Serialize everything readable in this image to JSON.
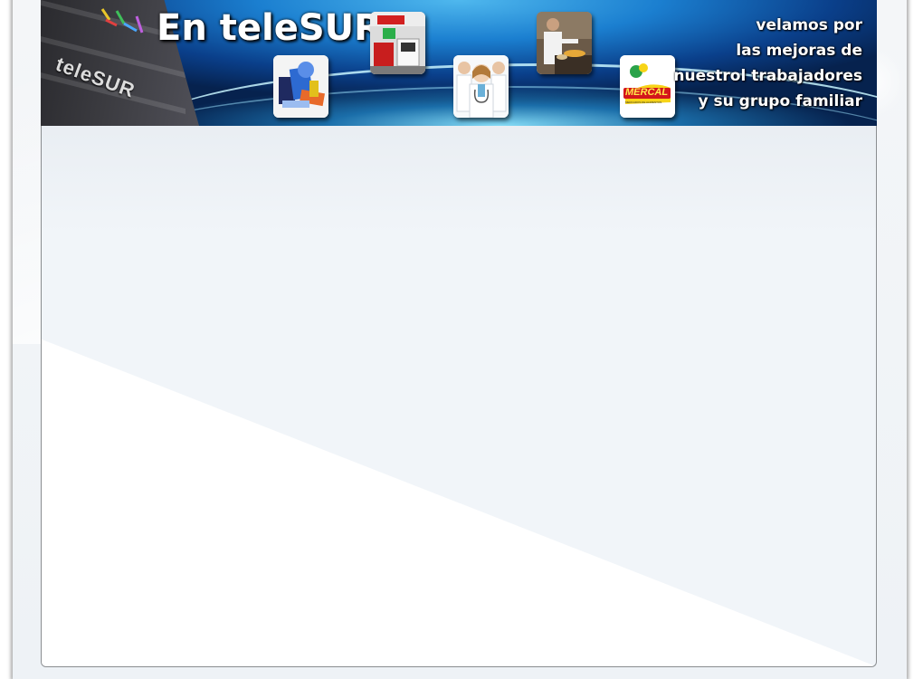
{
  "banner": {
    "title": "En teleSUR",
    "building_sign": "teleSUR",
    "slogan_lines": [
      "velamos por",
      "las mejoras de",
      "nuestrol trabajadores",
      "y su grupo familiar"
    ],
    "tiles": [
      {
        "id": "school-supplies",
        "icon": "school-supplies-photo"
      },
      {
        "id": "appliances-store",
        "icon": "appliances-store-photo"
      },
      {
        "id": "doctors",
        "icon": "doctors-photo"
      },
      {
        "id": "cook",
        "icon": "cook-photo"
      },
      {
        "id": "mercal",
        "icon": "mercal-logo",
        "logo_text": "MERCAL",
        "logo_subtext": "MERCADOS DE ALIMENTOS"
      }
    ]
  },
  "colors": {
    "banner_deep": "#06224e",
    "banner_mid": "#1b7fd0",
    "banner_glow": "#8ce6ff",
    "content_bg": "#f1f5f9",
    "mercal_red": "#d4161c",
    "mercal_yellow": "#f7d417"
  }
}
